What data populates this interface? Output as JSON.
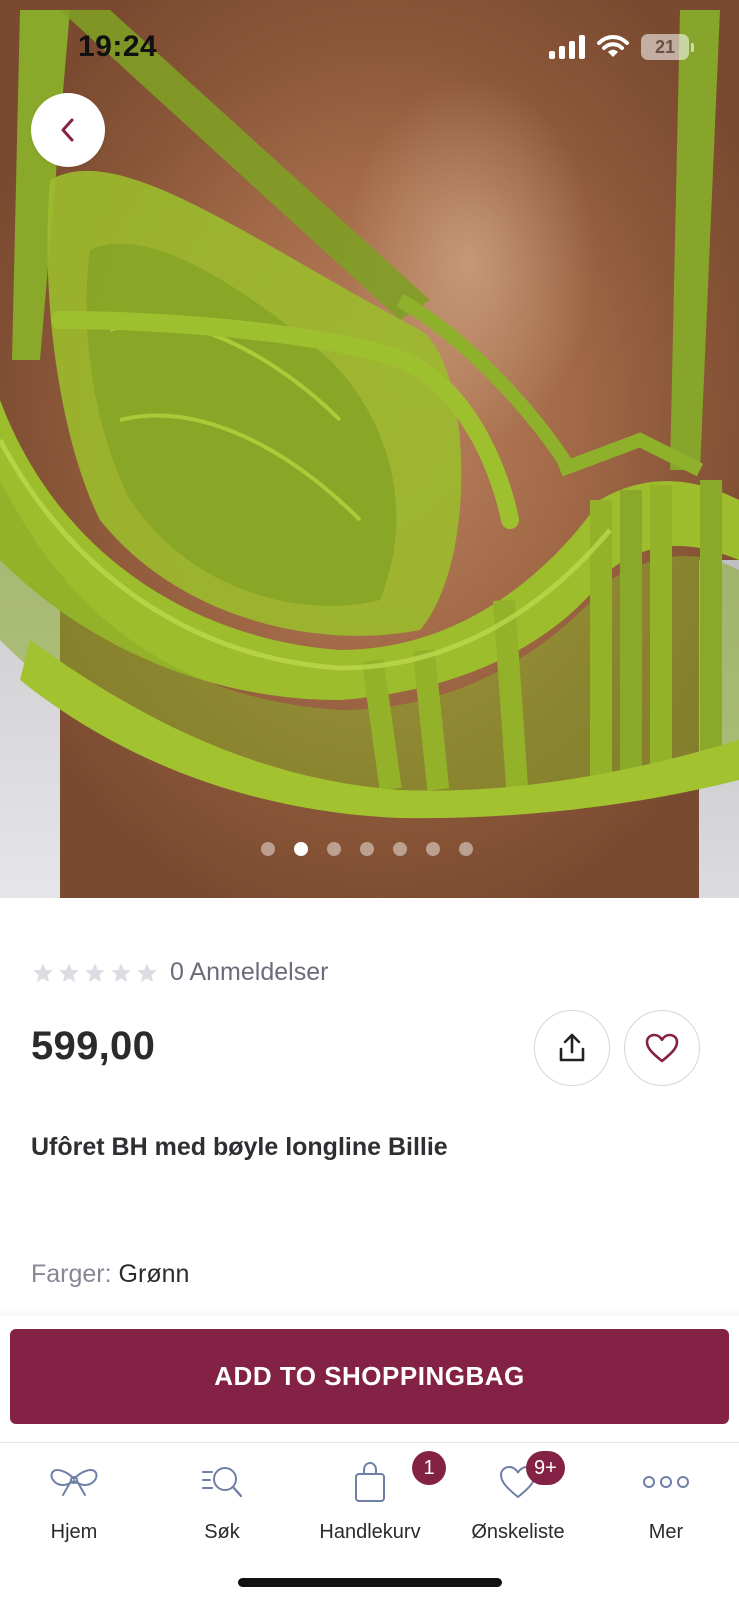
{
  "status_bar": {
    "time": "19:24",
    "battery": "21"
  },
  "gallery": {
    "page_count": 7,
    "active_index": 1
  },
  "product": {
    "rating": {
      "stars_filled": 0,
      "stars_total": 5,
      "reviews_text": "0 Anmeldelser"
    },
    "price": "599,00",
    "name": "Ufôret BH med bøyle longline Billie",
    "colors_label": "Farger:",
    "color_value": "Grønn"
  },
  "actions": {
    "add_to_bag": "ADD TO SHOPPINGBAG"
  },
  "tabbar": {
    "items": [
      {
        "label": "Hjem",
        "icon": "bow-icon"
      },
      {
        "label": "Søk",
        "icon": "search-icon"
      },
      {
        "label": "Handlekurv",
        "icon": "shopping-bag-icon",
        "badge": "1"
      },
      {
        "label": "Ønskeliste",
        "icon": "heart-icon",
        "badge": "9+"
      },
      {
        "label": "Mer",
        "icon": "more-dots-icon"
      }
    ]
  },
  "colors": {
    "accent": "#842245",
    "garment": "#8fb02a",
    "text": "#2b2b2b",
    "muted": "#8a8795"
  }
}
